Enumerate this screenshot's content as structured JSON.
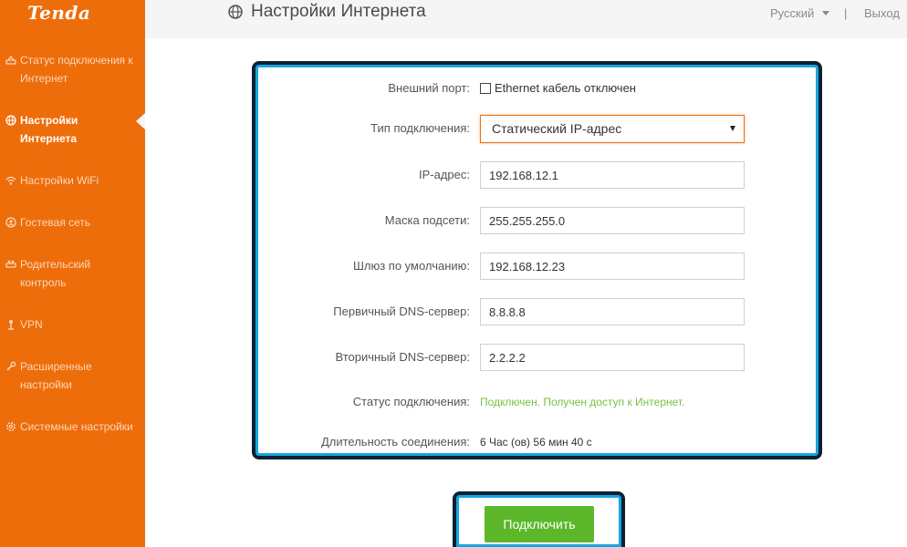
{
  "app": {
    "logo": "Tenda"
  },
  "sidebar": {
    "items": [
      {
        "label": "Статус подключения к Интернет",
        "icon": "connection-status-icon"
      },
      {
        "label": "Настройки Интернета",
        "icon": "globe-icon",
        "active": true
      },
      {
        "label": "Настройки WiFi",
        "icon": "wifi-icon"
      },
      {
        "label": "Гостевая сеть",
        "icon": "guest-network-icon"
      },
      {
        "label": "Родительский контроль",
        "icon": "parental-control-icon"
      },
      {
        "label": "VPN",
        "icon": "vpn-icon"
      },
      {
        "label": "Расширенные настройки",
        "icon": "wrench-icon"
      },
      {
        "label": "Системные настройки",
        "icon": "gear-icon"
      }
    ]
  },
  "header": {
    "title": "Настройки Интернета",
    "language": "Русский",
    "divider": "|",
    "logout": "Выход"
  },
  "form": {
    "wan_port": {
      "label": "Внешний порт:",
      "value": "Ethernet кабель отключен"
    },
    "connection_type": {
      "label": "Тип подключения:",
      "value": "Статический IP-адрес"
    },
    "ip_address": {
      "label": "IP-адрес:",
      "value": "192.168.12.1"
    },
    "subnet_mask": {
      "label": "Маска подсети:",
      "value": "255.255.255.0"
    },
    "gateway": {
      "label": "Шлюз по умолчанию:",
      "value": "192.168.12.23"
    },
    "primary_dns": {
      "label": "Первичный DNS-сервер:",
      "value": "8.8.8.8"
    },
    "secondary_dns": {
      "label": "Вторичный DNS-сервер:",
      "value": "2.2.2.2"
    },
    "status": {
      "label": "Статус подключения:",
      "value": "Подключен. Получен доступ к Интернет."
    },
    "duration": {
      "label": "Длительность соединения:",
      "value": "6 Час (ов) 56 мин 40 с"
    }
  },
  "actions": {
    "connect_label": "Подключить"
  },
  "colors": {
    "sidebar_bg": "#ee6d0b",
    "header_bg": "#f5f5f5",
    "connect_button": "#5cb82a",
    "status_ok": "#7ac142",
    "highlight_border": "#16a6e2"
  }
}
